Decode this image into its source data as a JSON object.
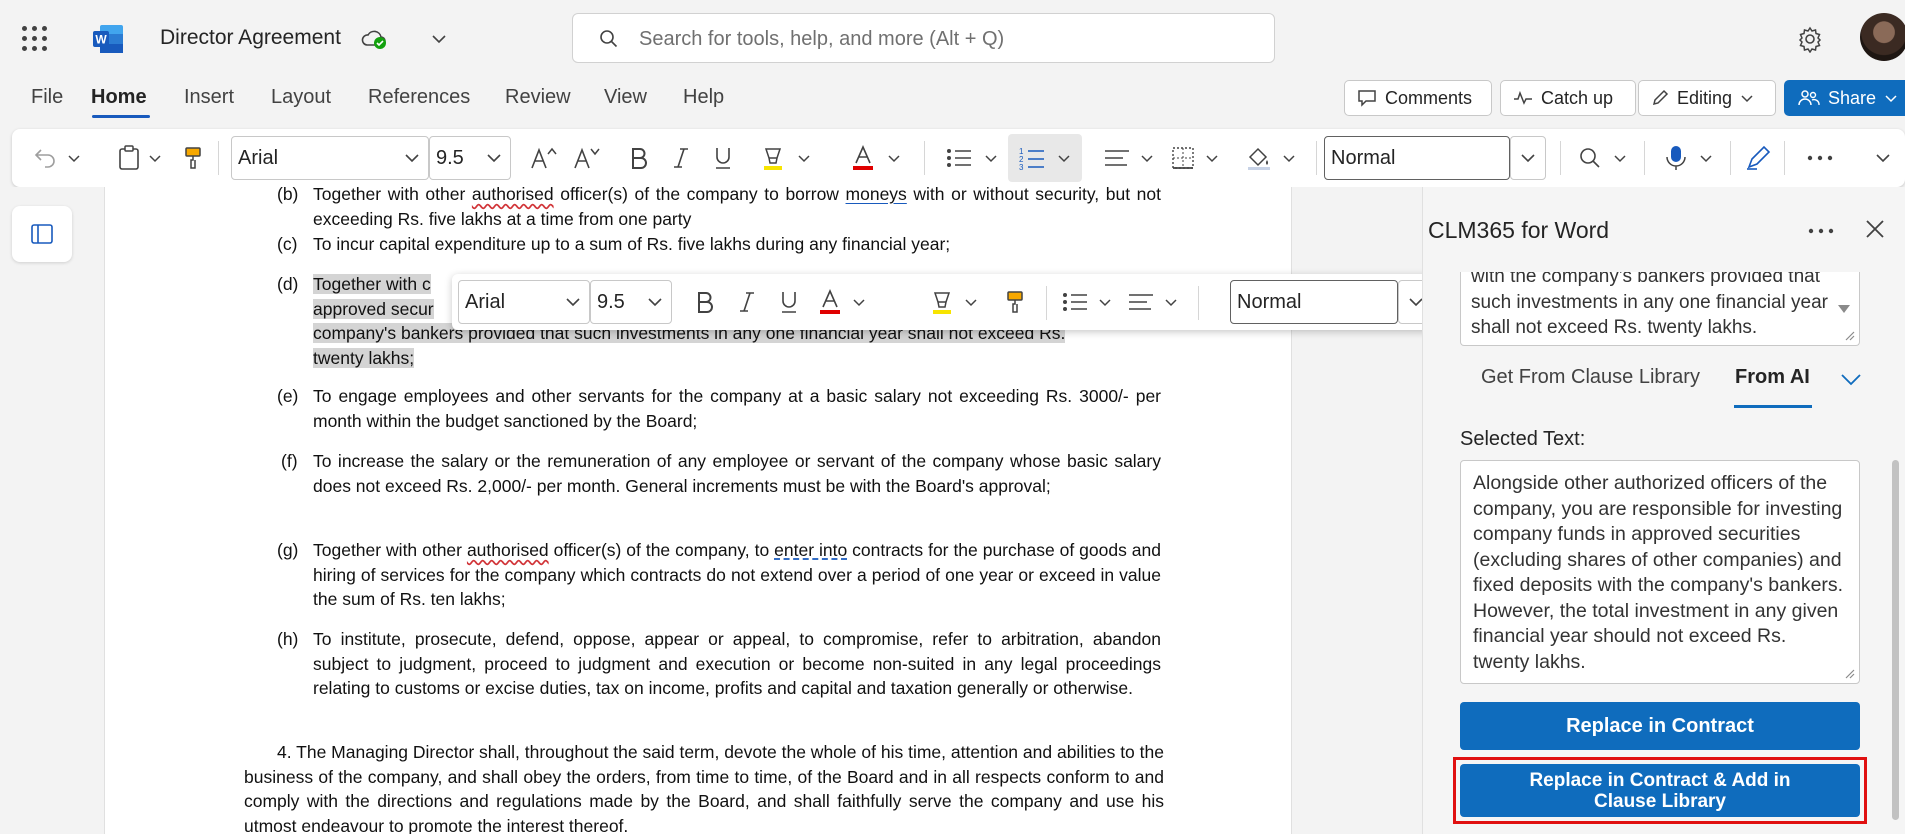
{
  "app": {
    "doc_title": "Director Agreement",
    "search_placeholder": "Search for tools, help, and more (Alt + Q)"
  },
  "tabs": [
    "File",
    "Home",
    "Insert",
    "Layout",
    "References",
    "Review",
    "View",
    "Help"
  ],
  "header_buttons": {
    "comments": "Comments",
    "catch_up": "Catch up",
    "editing": "Editing",
    "share": "Share"
  },
  "ribbon": {
    "font": "Arial",
    "size": "9.5",
    "style": "Normal"
  },
  "mini_toolbar": {
    "font": "Arial",
    "size": "9.5",
    "style": "Normal"
  },
  "document": {
    "b_label": "(b)",
    "b_text_1": "Together with other ",
    "b_sq": "authorised",
    "b_text_2": " officer(s) of the company to borrow ",
    "b_link": "moneys",
    "b_text_3": " with or without security, but not exceeding Rs. five lakhs at a time from one party",
    "c_label": "(c)",
    "c_text": "To incur capital expenditure up to a sum of Rs. five lakhs during any financial year;",
    "d_label": "(d)",
    "d_line1": "Together with c",
    "d_line2": "approved secur",
    "d_line3": "company's bankers provided that such investments in any one financial year shall not exceed Rs.",
    "d_line4": "twenty lakhs;",
    "e_label": "(e)",
    "e_text": "To engage employees and other servants for the company at a basic salary not exceeding Rs. 3000/- per month within the budget sanctioned by the Board;",
    "f_label": "(f)",
    "f_text": "To increase the salary or the remuneration of any employee or servant of the company whose basic salary does not exceed Rs. 2,000/- per month. General increments must be with the Board's approval;",
    "g_label": "(g)",
    "g_text_1": "Together with other ",
    "g_sq": "authorised",
    "g_text_2": " officer(s) of the company, to ",
    "g_link": "enter into",
    "g_text_3": " contracts for the purchase of goods and hiring of services for the company which contracts do not extend over a period of one year or exceed in value the sum of Rs. ten lakhs;",
    "h_label": "(h)",
    "h_text": "To institute, prosecute, defend, oppose, appear or appeal, to compromise, refer to arbitration, abandon subject to judgment, proceed to judgment and execution or become non-suited in any legal proceedings relating to customs or excise duties, tax on income, profits and capital and taxation generally or otherwise.",
    "p4_text_1": "4. The Managing Director shall, throughout the said term, devote the whole of his time, attention and abilities to the business of the company, and shall obey the orders, from time to time, of the Board and in all respects conform to and comply with the directions and regulations made by the Board, and shall faithfully serve the company and use his utmost ",
    "p4_sq": "endeavour",
    "p4_text_2": " to promote the interest thereof."
  },
  "pane": {
    "title": "CLM365 for Word",
    "prev_text": "with the company's bankers provided that such investments in any one financial year shall not exceed Rs. twenty lakhs.",
    "tab_library": "Get From Clause Library",
    "tab_ai": "From AI",
    "selected_label": "Selected Text:",
    "selected_text": "Alongside other authorized officers of the company, you are responsible for investing company funds in approved securities (excluding shares of other companies) and fixed deposits with the company's bankers. However, the total investment in any given financial year should not exceed Rs. twenty lakhs.",
    "btn_replace": "Replace in Contract",
    "btn_replace_add": "Replace in Contract & Add in Clause Library"
  },
  "colors": {
    "accent": "#0f6cbd",
    "highlight": "#e01010"
  }
}
